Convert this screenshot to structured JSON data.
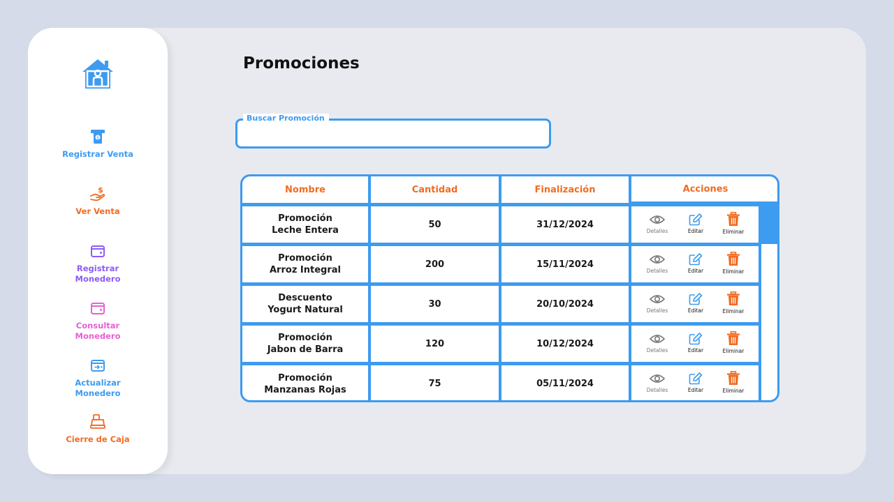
{
  "colors": {
    "primary_blue": "#3d9bf0",
    "orange": "#f26b21",
    "purple": "#8b5cf6",
    "pink": "#e85fd6",
    "background": "#e8eaf0",
    "outer_background": "#d5dbe8"
  },
  "sidebar": {
    "home_icon": "home-icon",
    "items": [
      {
        "label": "Registrar Venta",
        "icon": "atm-cash-icon",
        "color": "#3d9bf0"
      },
      {
        "label": "Ver Venta",
        "icon": "hand-money-icon",
        "color": "#f26b21"
      },
      {
        "label": "Registrar\nMonedero",
        "icon": "wallet-icon",
        "color": "#8b5cf6"
      },
      {
        "label": "Consultar\nMonedero",
        "icon": "wallet-icon",
        "color": "#e85fd6"
      },
      {
        "label": "Actualizar\nMonedero",
        "icon": "wallet-transfer-icon",
        "color": "#3d9bf0"
      },
      {
        "label": "Cierre de Caja",
        "icon": "cash-register-icon",
        "color": "#f26b21"
      }
    ]
  },
  "page": {
    "title": "Promociones"
  },
  "search": {
    "label": "Buscar Promoción",
    "value": ""
  },
  "table": {
    "headers": [
      "Nombre",
      "Cantidad",
      "Finalización",
      "Acciones"
    ],
    "action_labels": {
      "details": "Detalles",
      "edit": "Editar",
      "delete": "Eliminar"
    },
    "rows": [
      {
        "nombre": "Promoción\nLeche Entera",
        "cantidad": "50",
        "finalizacion": "31/12/2024"
      },
      {
        "nombre": "Promoción\nArroz Integral",
        "cantidad": "200",
        "finalizacion": "15/11/2024"
      },
      {
        "nombre": "Descuento\nYogurt Natural",
        "cantidad": "30",
        "finalizacion": "20/10/2024"
      },
      {
        "nombre": "Promoción\nJabon de Barra",
        "cantidad": "120",
        "finalizacion": "10/12/2024"
      },
      {
        "nombre": "Promoción\nManzanas Rojas",
        "cantidad": "75",
        "finalizacion": "05/11/2024"
      }
    ]
  }
}
